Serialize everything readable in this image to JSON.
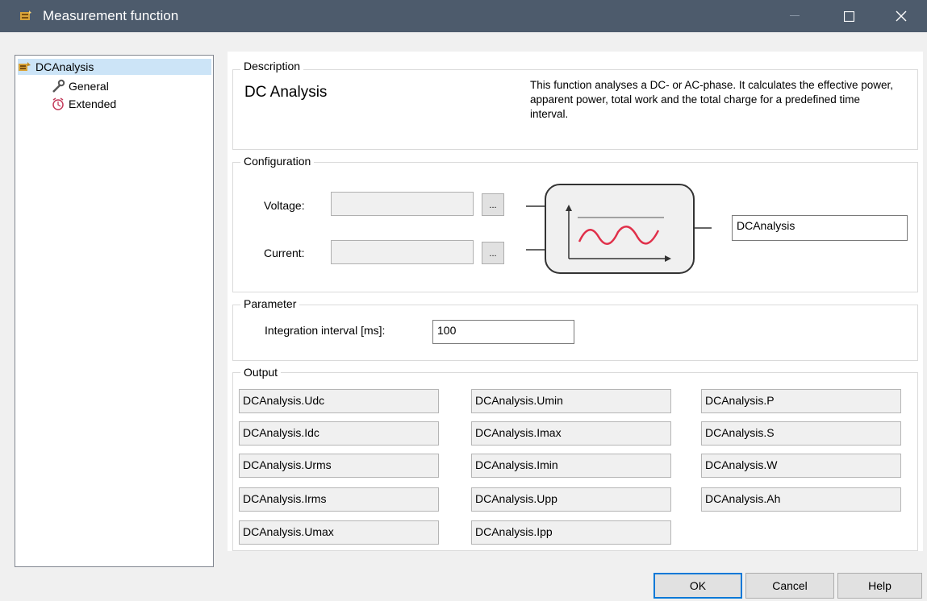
{
  "window": {
    "title": "Measurement function",
    "icon": "app-icon"
  },
  "tree": {
    "items": [
      {
        "label": "DCAnalysis",
        "icon": "function-icon",
        "selected": true
      },
      {
        "label": "General",
        "icon": "wrench-icon"
      },
      {
        "label": "Extended",
        "icon": "clock-icon"
      }
    ]
  },
  "description": {
    "group_label": "Description",
    "title": "DC Analysis",
    "text": "This function analyses a DC- or AC-phase. It calculates the effective power, apparent power, total work and the total charge for a predefined time interval."
  },
  "configuration": {
    "group_label": "Configuration",
    "voltage_label": "Voltage:",
    "voltage_value": "",
    "current_label": "Current:",
    "current_value": "",
    "browse_label": "...",
    "name_value": "DCAnalysis"
  },
  "parameter": {
    "group_label": "Parameter",
    "interval_label": "Integration interval [ms]:",
    "interval_value": "100"
  },
  "output": {
    "group_label": "Output",
    "col1": [
      "DCAnalysis.Udc",
      "DCAnalysis.Idc",
      "DCAnalysis.Urms",
      "DCAnalysis.Irms",
      "DCAnalysis.Umax"
    ],
    "col2": [
      "DCAnalysis.Umin",
      "DCAnalysis.Imax",
      "DCAnalysis.Imin",
      "DCAnalysis.Upp",
      "DCAnalysis.Ipp"
    ],
    "col3": [
      "DCAnalysis.P",
      "DCAnalysis.S",
      "DCAnalysis.W",
      "DCAnalysis.Ah"
    ]
  },
  "buttons": {
    "ok": "OK",
    "cancel": "Cancel",
    "help": "Help"
  },
  "colors": {
    "titlebar": "#4d5b6c",
    "selection": "#cce4f7",
    "wave": "#e0304a",
    "accent": "#0078d7"
  }
}
